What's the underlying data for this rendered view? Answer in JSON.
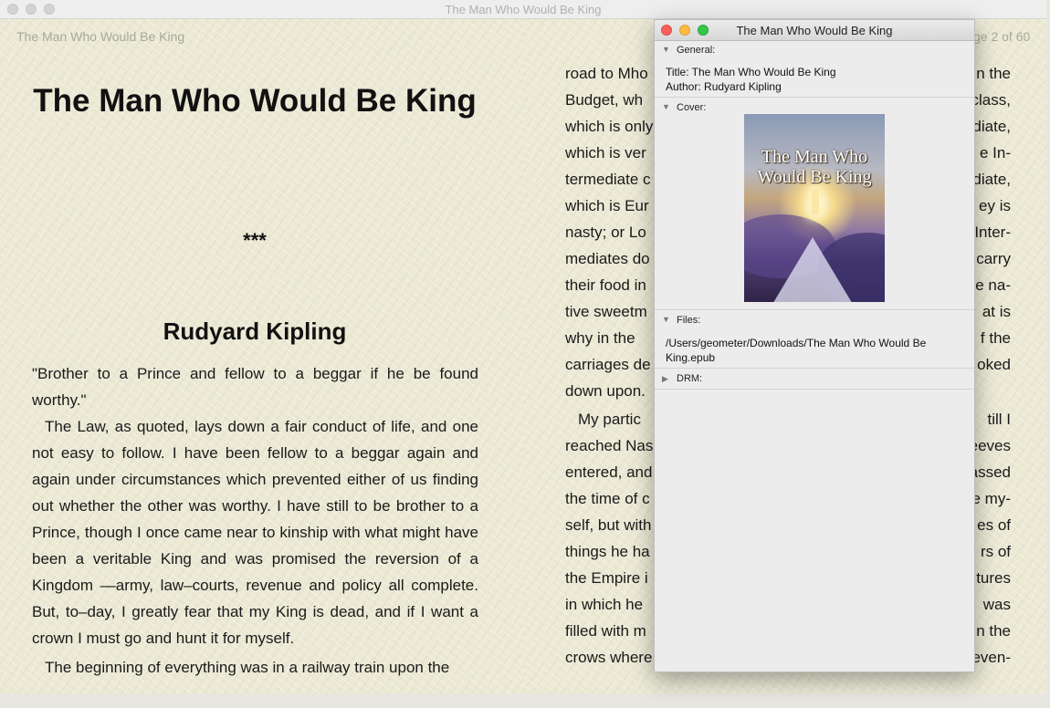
{
  "window": {
    "title": "The Man Who Would Be King"
  },
  "left_page": {
    "running_header": "The Man Who Would Be King",
    "book_title": "The Man Who Would Be King",
    "separator": "***",
    "author": "Rudyard Kipling",
    "paragraphs": [
      "\"Brother to a Prince and fellow to a beggar if he be found worthy.\"",
      "The Law, as quoted, lays down a fair conduct of life, and one not easy to follow. I have been fellow to a beggar again and again under circumstances which prevented either of us finding out whether the other was worthy. I have still to be brother to a Prince, though I once came near to kinship with what might have been a veritable King and was promised the reversion of a Kingdom —army, law–courts, revenue and policy all complete. But, to–day, I greatly fear that my King is dead, and if I want a crown I must go and hunt it for myself.",
      "The beginning of everything was in a railway train upon the"
    ]
  },
  "right_page": {
    "page_indicator": "ge 2 of 60",
    "lines_a": [
      [
        "road to Mho",
        "n the"
      ],
      [
        "Budget, wh",
        "class,"
      ],
      [
        "which is only",
        "diate,"
      ],
      [
        "which is ver",
        "e In-"
      ],
      [
        "termediate c",
        "diate,"
      ],
      [
        "which is Eur",
        "ey is"
      ],
      [
        "nasty; or Lo",
        "Inter-"
      ],
      [
        "mediates do",
        "carry"
      ],
      [
        "their food in",
        "e na-"
      ],
      [
        "tive sweetm",
        "at is"
      ],
      [
        "why in the",
        "f the"
      ],
      [
        "carriages de",
        "oked"
      ],
      [
        "down upon.",
        ""
      ]
    ],
    "lines_b": [
      [
        "My partic",
        "till I"
      ],
      [
        "reached Nas",
        "eeves"
      ],
      [
        "entered, and",
        "assed"
      ],
      [
        "the time of c",
        "e my-"
      ],
      [
        "self, but with",
        "es of"
      ],
      [
        "things he ha",
        "rs of"
      ],
      [
        "the Empire i",
        "tures"
      ],
      [
        "in which he",
        "was"
      ],
      [
        "filled with m",
        "n the"
      ],
      [
        "crows where",
        "even-"
      ]
    ]
  },
  "info_panel": {
    "title": "The Man Who Would Be King",
    "general": {
      "header": "General:",
      "title_line": "Title: The Man Who Would Be King",
      "author_line": "Author: Rudyard Kipling"
    },
    "cover": {
      "header": "Cover:",
      "image_title": "The Man Who Would Be King"
    },
    "files": {
      "header": "Files:",
      "path": "/Users/geometer/Downloads/The Man Who Would Be King.epub"
    },
    "drm": {
      "header": "DRM:"
    }
  }
}
